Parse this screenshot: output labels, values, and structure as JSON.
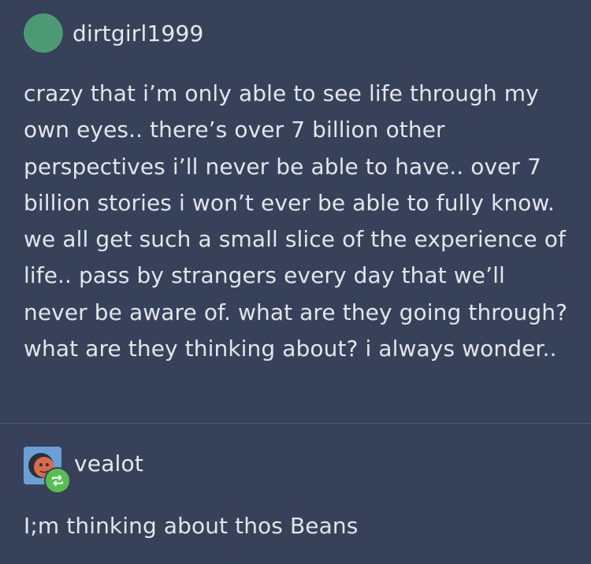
{
  "posts": [
    {
      "username": "dirtgirl1999",
      "avatar_color": "#4b9a73",
      "avatar_icon": "green-circle-avatar",
      "text": "crazy that i’m only able to see life through my own eyes.. there’s over 7 billion other perspectives i’ll never be able to have.. over 7 billion stories i won’t ever be able to fully know. we all get such a small slice of the experience of life.. pass by strangers every day that we’ll never be aware of. what are they going through? what are they thinking about? i always wonder.."
    },
    {
      "username": "vealot",
      "avatar_icon": "face-avatar",
      "reblog_icon": "reblog-icon",
      "reblog_color": "#56c04f",
      "text": "I;m thinking about thos Beans"
    }
  ],
  "background_color": "#37425a"
}
